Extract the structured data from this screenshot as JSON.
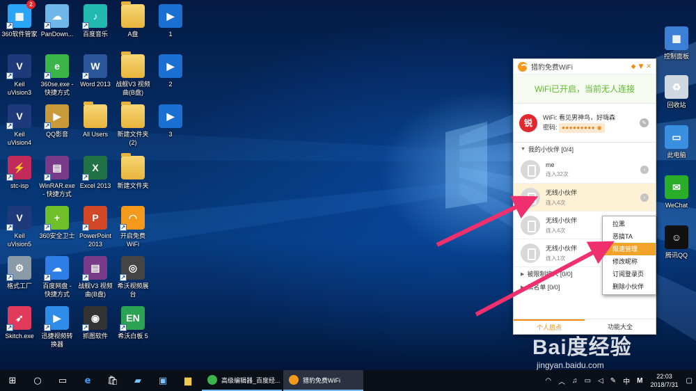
{
  "desktop_icons": {
    "c1": [
      {
        "label": "360软件管家",
        "icon": "360-software-manager-icon",
        "color": "#2aa4f4",
        "badge": "2"
      },
      {
        "label": "Keil\nuVision3",
        "icon": "keil-uvision3-icon",
        "color": "#1f3a7a"
      },
      {
        "label": "Keil\nuVision4",
        "icon": "keil-uvision4-icon",
        "color": "#1f3a7a"
      },
      {
        "label": "stc-isp",
        "icon": "stc-isp-icon",
        "color": "#c22a5a"
      },
      {
        "label": "Keil\nuVision5",
        "icon": "keil-uvision5-icon",
        "color": "#1f3a7a"
      },
      {
        "label": "格式工厂",
        "icon": "format-factory-icon",
        "color": "#8a9aa8"
      },
      {
        "label": "Skitch.exe",
        "icon": "skitch-icon",
        "color": "#e23a5a"
      }
    ],
    "c2": [
      {
        "label": "PanDown...",
        "icon": "pandownload-icon",
        "color": "#6fb7e8"
      },
      {
        "label": "360se.exe -\n快捷方式",
        "icon": "360-browser-icon",
        "color": "#3bb54a"
      },
      {
        "label": "QQ影音",
        "icon": "qq-player-icon",
        "color": "#c99a3a"
      },
      {
        "label": "WinRAR.exe\n- 快捷方式",
        "icon": "winrar-icon",
        "color": "#7a3a8a"
      },
      {
        "label": "360安全卫士",
        "icon": "360-safeguard-icon",
        "color": "#6fbf2a"
      },
      {
        "label": "百度网盘 -\n快捷方式",
        "icon": "baidu-netdisk-icon",
        "color": "#2f7ee8"
      },
      {
        "label": "迅捷视频转\n换器",
        "icon": "video-converter-icon",
        "color": "#2d8ce8"
      }
    ],
    "c3": [
      {
        "label": "百度音乐",
        "icon": "baidu-music-icon",
        "color": "#22b9b0"
      },
      {
        "label": "Word 2013",
        "icon": "word-2013-icon",
        "color": "#2b579a"
      },
      {
        "label": "All Users",
        "icon": "folder-icon",
        "color": "#e8b43e"
      },
      {
        "label": "Excel 2013",
        "icon": "excel-2013-icon",
        "color": "#217346"
      },
      {
        "label": "PowerPoint\n2013",
        "icon": "powerpoint-2013-icon",
        "color": "#d24726"
      },
      {
        "label": "战舰V3 视频\n曲(B盘)",
        "icon": "winrar-icon",
        "color": "#7a3a8a"
      },
      {
        "label": "抓图软件",
        "icon": "camera-icon",
        "color": "#333333"
      }
    ],
    "c4": [
      {
        "label": "A盘",
        "icon": "folder-icon",
        "color": "#e8b43e"
      },
      {
        "label": "战舰V3 视频\n曲(B盘)",
        "icon": "folder-icon",
        "color": "#e8b43e"
      },
      {
        "label": "新建文件夹\n(2)",
        "icon": "folder-icon",
        "color": "#e8b43e"
      },
      {
        "label": "新建文件夹",
        "icon": "folder-icon",
        "color": "#e8b43e"
      },
      {
        "label": "开启免费\nWiFi",
        "icon": "free-wifi-icon",
        "color": "#f39a1d"
      },
      {
        "label": "希沃视频展\n台",
        "icon": "seewo-camera-icon",
        "color": "#444444"
      },
      {
        "label": "希沃白板 5",
        "icon": "seewo-whiteboard-icon",
        "color": "#2aa452"
      }
    ],
    "c5": [
      {
        "label": "1",
        "icon": "video-file-icon",
        "color": "#1a6fd1"
      },
      {
        "label": "2",
        "icon": "video-file-icon",
        "color": "#1a6fd1"
      },
      {
        "label": "3",
        "icon": "video-file-icon",
        "color": "#1a6fd1"
      }
    ],
    "right": [
      {
        "label": "控制面板",
        "icon": "control-panel-icon",
        "color": "#3c7fd6"
      },
      {
        "label": "回收站",
        "icon": "recycle-bin-icon",
        "color": "#cfd8e0"
      },
      {
        "label": "此电脑",
        "icon": "this-pc-icon",
        "color": "#3a8fe0"
      },
      {
        "label": "WeChat",
        "icon": "wechat-icon",
        "color": "#2aae2a"
      },
      {
        "label": "腾讯QQ",
        "icon": "qq-icon",
        "color": "#111111"
      }
    ]
  },
  "wifi_panel": {
    "title": "猎豹免费WiFi",
    "status": "WiFi已开启，当前无人连接",
    "avatar_text": "锐",
    "wifi_label": "WiFi:",
    "wifi_name": "看见男神鸟，好嗨森",
    "password_label": "密码:",
    "password_mask": "●●●●●●●●●",
    "my_partners_label": "我的小伙伴",
    "my_partners_count": "[0/4]",
    "partners": [
      {
        "name": "me",
        "detail": "连入32次"
      },
      {
        "name": "无线小伙伴",
        "detail": "连入4次"
      },
      {
        "name": "无线小伙伴",
        "detail": "连入4次"
      },
      {
        "name": "无线小伙伴",
        "detail": "连入1次"
      }
    ],
    "blocked_label": "被限制接入",
    "blocked_count": "[0/0]",
    "blacklist_label": "黑名单",
    "blacklist_count": "[0/0]",
    "tab_hotspot": "个人热点",
    "tab_features": "功能大全"
  },
  "context_menu": {
    "items": [
      "拉黑",
      "恶搞TA",
      "限速管理",
      "修改昵称",
      "订阅登录页",
      "删除小伙伴"
    ],
    "selected": "限速管理"
  },
  "taskbar": {
    "apps": [
      {
        "label": "高级编辑器_百度经...",
        "icon": "360-browser-icon",
        "color": "#3bb54a"
      },
      {
        "label": "猎豹免费WiFi",
        "icon": "free-wifi-icon",
        "color": "#f39a1d"
      }
    ],
    "ime": "中",
    "clock_time": "22:03",
    "clock_date": "2018/7/31"
  },
  "watermark": {
    "brand": "Bai度经验",
    "url": "jingyan.baidu.com"
  },
  "colors": {
    "accent_orange": "#f08b13",
    "status_green": "#5fb82d",
    "arrow_pink": "#f0306e"
  }
}
